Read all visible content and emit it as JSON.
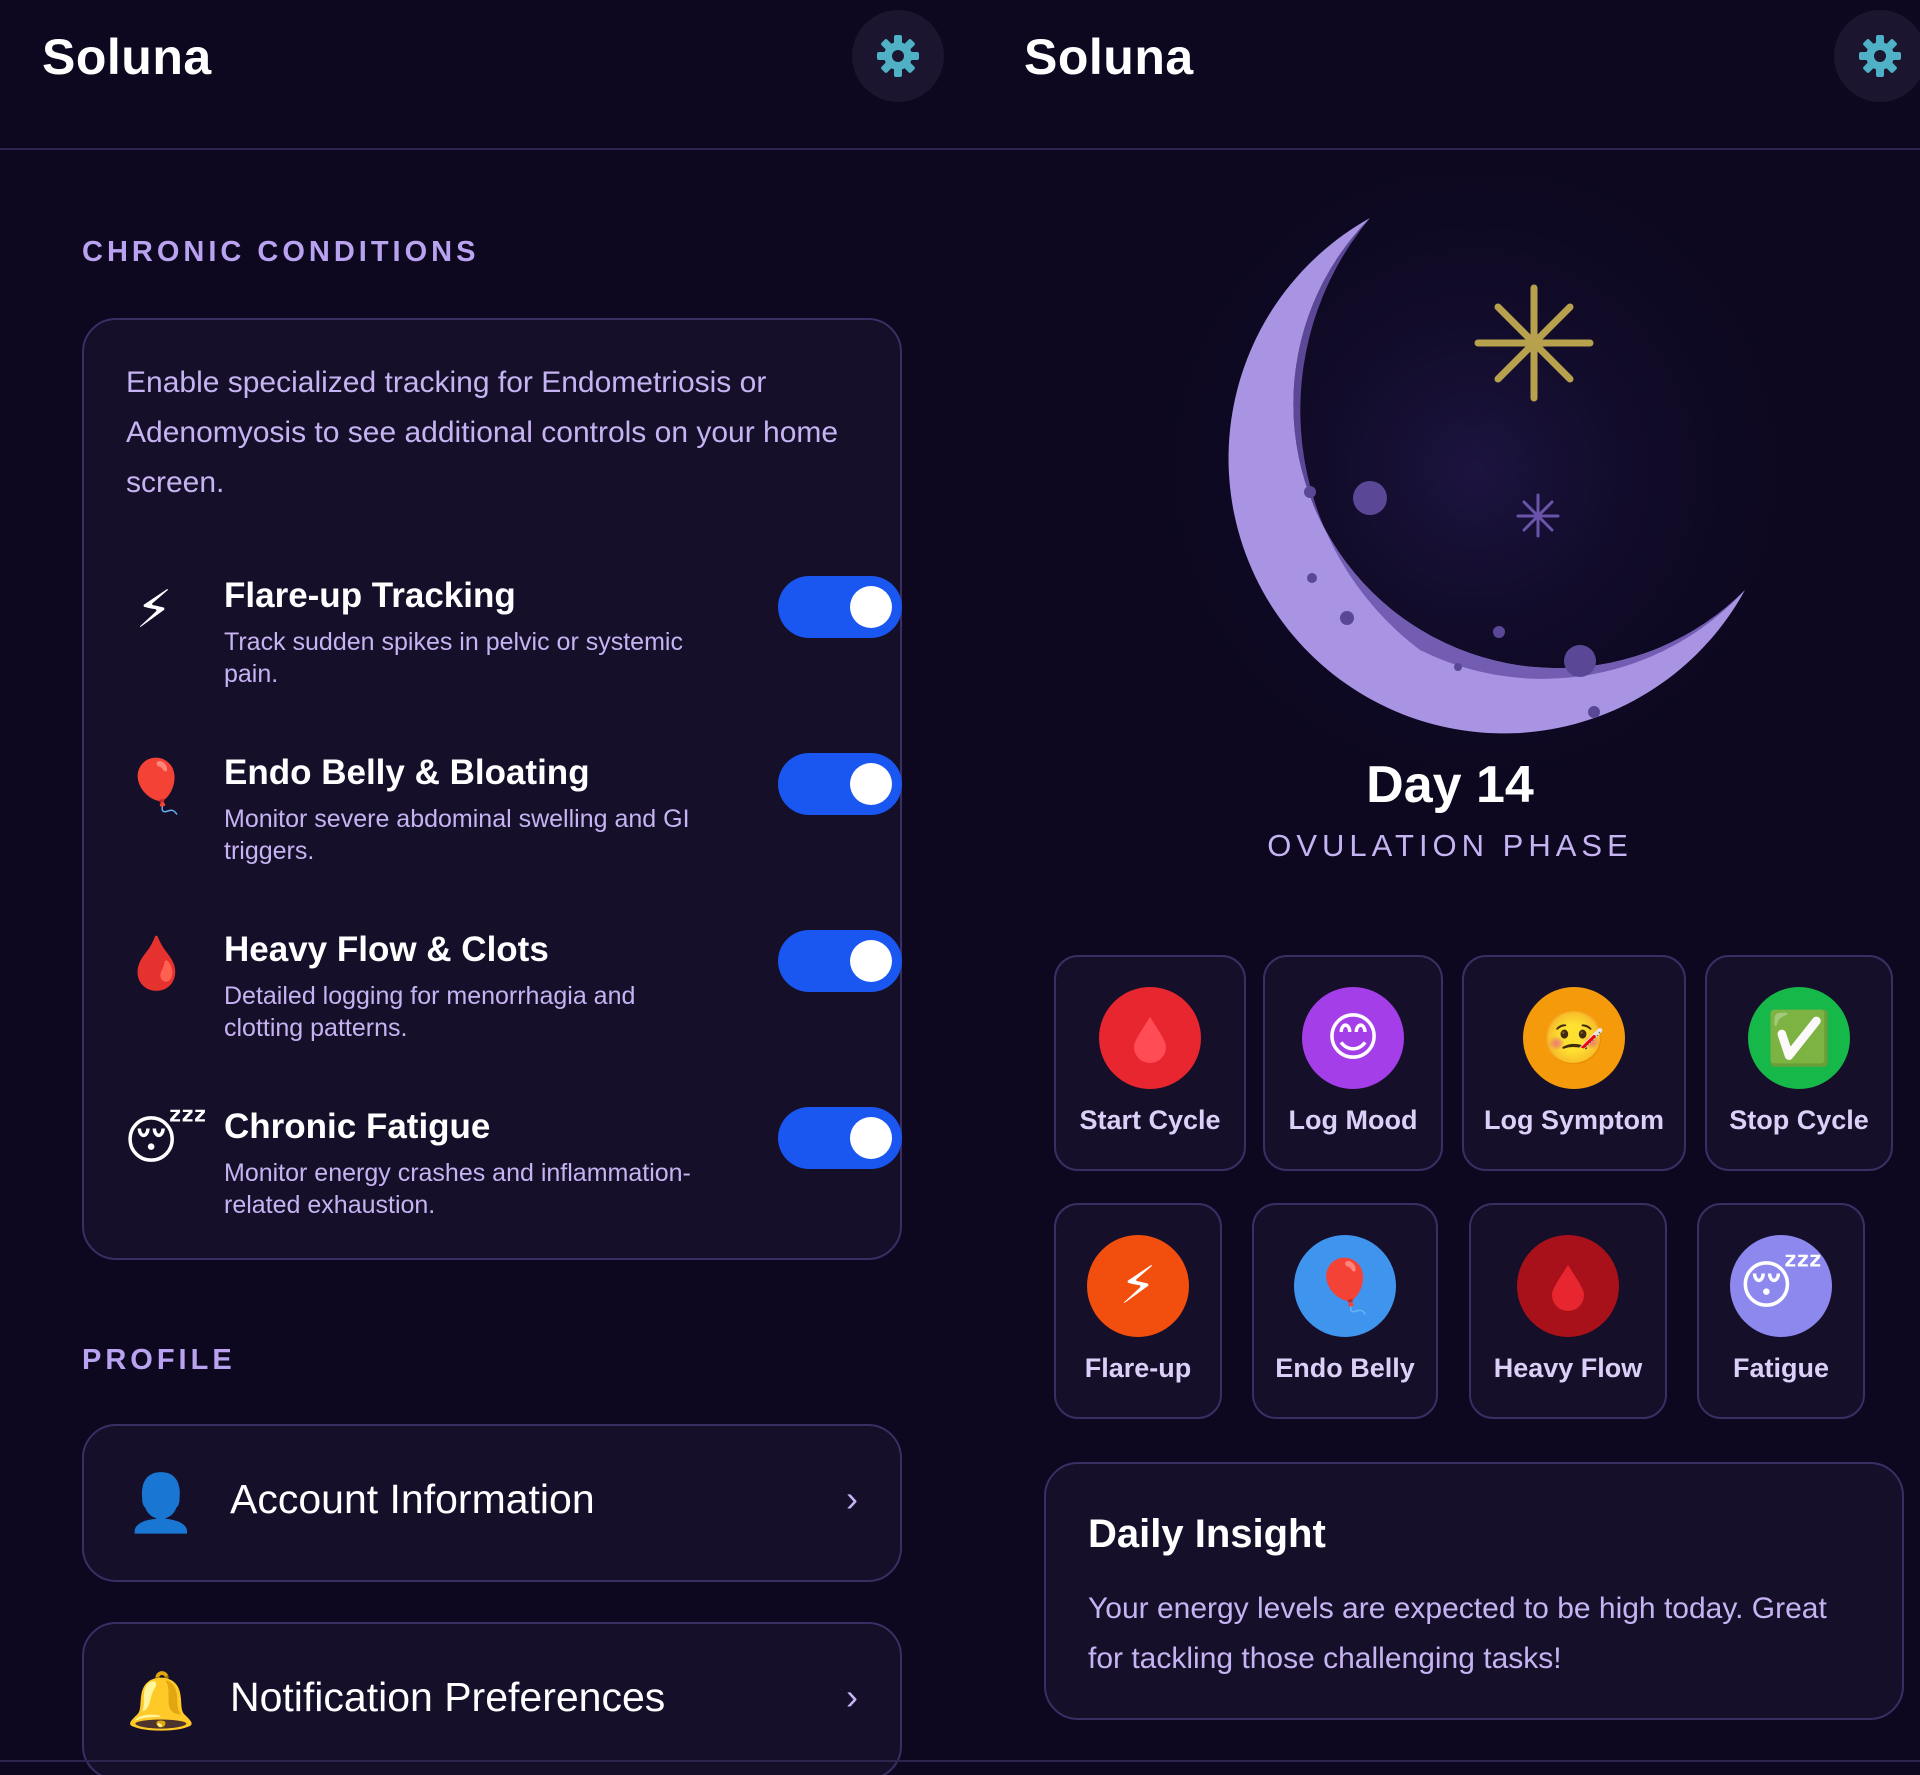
{
  "app": {
    "title": "Soluna"
  },
  "settings": {
    "sections": {
      "chronic": "CHRONIC CONDITIONS",
      "profile": "PROFILE"
    },
    "intro": "Enable specialized tracking for Endometriosis or Adenomyosis to see additional controls on your home screen.",
    "conditions": [
      {
        "title": "Flare-up Tracking",
        "desc": "Track sudden spikes in pelvic or systemic pain.",
        "icon": "lightning-icon",
        "enabled": true
      },
      {
        "title": "Endo Belly & Bloating",
        "desc": "Monitor severe abdominal swelling and GI triggers.",
        "icon": "balloon-icon",
        "enabled": true
      },
      {
        "title": "Heavy Flow & Clots",
        "desc": "Detailed logging for menorrhagia and clotting patterns.",
        "icon": "drop-icon",
        "enabled": true
      },
      {
        "title": "Chronic Fatigue",
        "desc": "Monitor energy crashes and inflammation-related exhaustion.",
        "icon": "sleepy-face-icon",
        "enabled": true
      }
    ],
    "profile_links": [
      {
        "label": "Account Information",
        "icon": "person-icon",
        "chevron": "›"
      },
      {
        "label": "Notification Preferences",
        "icon": "bell-icon",
        "chevron": "›"
      }
    ]
  },
  "home": {
    "day": "Day 14",
    "phase": "OVULATION PHASE",
    "actions": [
      {
        "label": "Start Cycle",
        "icon": "drop-icon",
        "color": "#e8262f"
      },
      {
        "label": "Log Mood",
        "icon": "smile-icon",
        "color": "#a33ee8"
      },
      {
        "label": "Log Symptom",
        "icon": "sick-face-icon",
        "color": "#f59b0b"
      },
      {
        "label": "Stop Cycle",
        "icon": "checkmark-icon",
        "color": "#17b84a"
      }
    ],
    "condition_actions": [
      {
        "label": "Flare-up",
        "icon": "lightning-icon",
        "color": "#f24e0d"
      },
      {
        "label": "Endo Belly",
        "icon": "balloon-icon",
        "color": "#3f95ee"
      },
      {
        "label": "Heavy Flow",
        "icon": "drop-icon",
        "color": "#a8111a"
      },
      {
        "label": "Fatigue",
        "icon": "sleepy-face-icon",
        "color": "#8d88ee"
      }
    ],
    "insight": {
      "title": "Daily Insight",
      "body": "Your energy levels are expected to be high today. Great for tackling those challenging tasks!"
    }
  },
  "colors": {
    "background": "#0d0820",
    "card": "#150f2a",
    "accent": "#b9a3f0",
    "toggle": "#1a56f0"
  }
}
